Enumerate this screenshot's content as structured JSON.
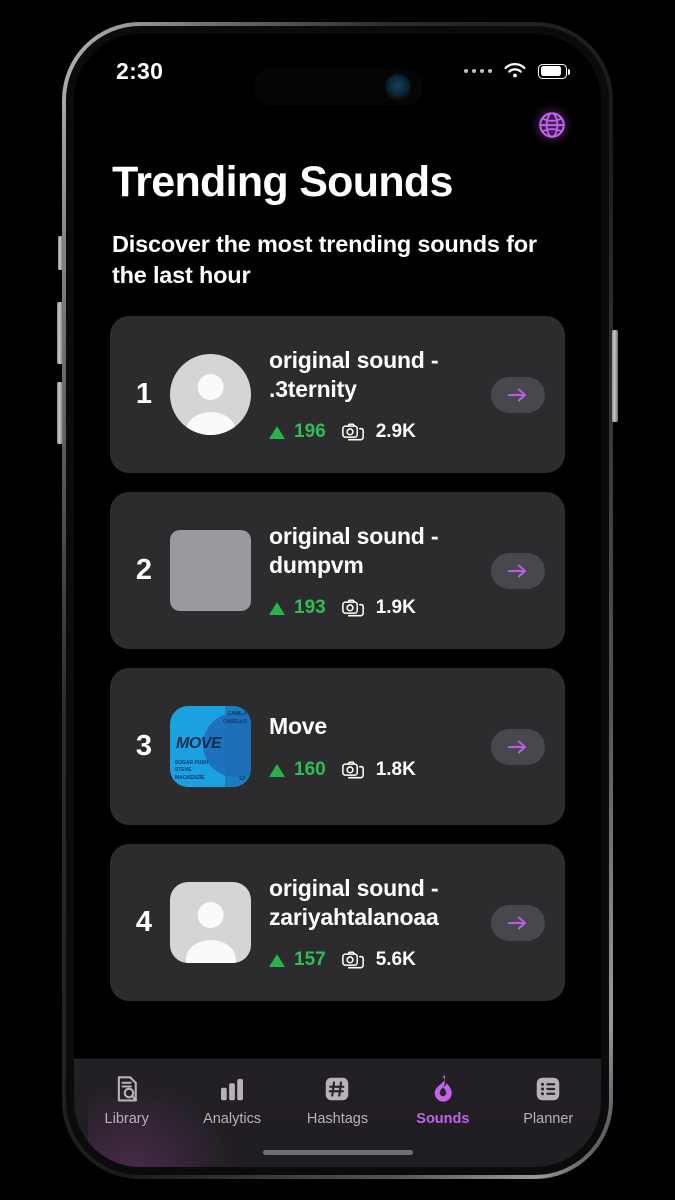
{
  "status_bar": {
    "time": "2:30",
    "cellular_icon": "signal-dots-icon",
    "wifi_icon": "wifi-icon",
    "battery_icon": "battery-icon"
  },
  "header": {
    "globe_icon": "globe-icon",
    "title": "Trending Sounds",
    "subtitle": "Discover the most trending sounds for the last hour"
  },
  "colors": {
    "accent_purple": "#c163e8",
    "arrow_purple": "#b060e8",
    "delta_green": "#2fbd55",
    "card_bg": "#2c2c2e",
    "screen_bg": "#000000"
  },
  "sounds": [
    {
      "rank": "1",
      "title": "original sound - .3ternity",
      "delta": "196",
      "videos": "2.9K",
      "thumb_type": "avatar-circle",
      "trend_icon": "triangle-up-icon",
      "videos_icon": "camera-stack-icon",
      "open_icon": "arrow-right-icon"
    },
    {
      "rank": "2",
      "title": "original sound - dumpvm",
      "delta": "193",
      "videos": "1.9K",
      "thumb_type": "placeholder-square",
      "trend_icon": "triangle-up-icon",
      "videos_icon": "camera-stack-icon",
      "open_icon": "arrow-right-icon"
    },
    {
      "rank": "3",
      "title": "Move",
      "delta": "160",
      "videos": "1.8K",
      "thumb_type": "album-art",
      "art_word": "MOVE",
      "art_top_right": "CAMILA\nCABELLO",
      "art_bottom_left": "SUGAR PUSH\nSTEVE\nMACKENZIE",
      "art_bottom_right": "EP",
      "trend_icon": "triangle-up-icon",
      "videos_icon": "camera-stack-icon",
      "open_icon": "arrow-right-icon"
    },
    {
      "rank": "4",
      "title": "original sound - zariyahtalanoaa",
      "delta": "157",
      "videos": "5.6K",
      "thumb_type": "avatar-rounded",
      "trend_icon": "triangle-up-icon",
      "videos_icon": "camera-stack-icon",
      "open_icon": "arrow-right-icon"
    }
  ],
  "tabs": [
    {
      "label": "Library",
      "icon": "document-search-icon",
      "active": false
    },
    {
      "label": "Analytics",
      "icon": "bar-chart-icon",
      "active": false
    },
    {
      "label": "Hashtags",
      "icon": "hashtag-icon",
      "active": false
    },
    {
      "label": "Sounds",
      "icon": "flame-icon",
      "active": true
    },
    {
      "label": "Planner",
      "icon": "list-icon",
      "active": false
    }
  ]
}
